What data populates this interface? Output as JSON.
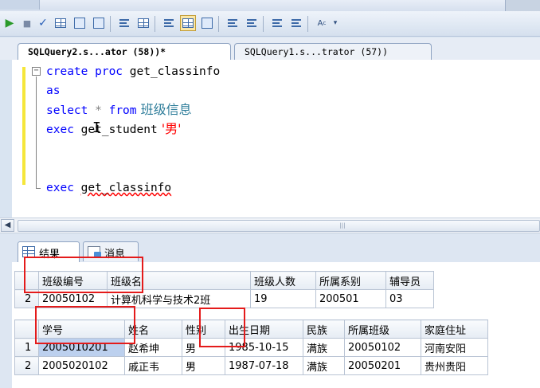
{
  "toolbar": {
    "buttons": [
      "execute",
      "stop",
      "parse",
      "display-estimated-plan",
      "query-options",
      "intellisense",
      "results-to-text",
      "results-to-grid",
      "results-to-file",
      "comment-out",
      "uncomment",
      "decrease-indent",
      "increase-indent",
      "specify-template-values"
    ],
    "active_button": "results-to-grid"
  },
  "tabs": [
    {
      "label": "SQLQuery2.s...ator (58))*",
      "active": true
    },
    {
      "label": "SQLQuery1.s...trator (57))",
      "active": false
    }
  ],
  "editor": {
    "lines": [
      {
        "kw1": "create proc",
        "rest": " get_classinfo"
      },
      {
        "kw1": "as"
      },
      {
        "kw1": "select",
        "star": " * ",
        "kw2": "from",
        "table": " 班级信息"
      },
      {
        "kw1": "exec",
        "proc": " get_student",
        "str": " '男'"
      },
      {
        "kw1": "exec",
        "proc2": "get_classinfo"
      }
    ]
  },
  "results": {
    "tabs": [
      "结果",
      "消息"
    ],
    "grid1": {
      "columns": [
        "班级编号",
        "班级名",
        "班级人数",
        "所属系别",
        "辅导员"
      ],
      "rows": [
        {
          "num": "2",
          "cells": [
            "20050102",
            "计算机科学与技术2班",
            "19",
            "200501",
            "03"
          ]
        }
      ]
    },
    "grid2": {
      "columns": [
        "学号",
        "姓名",
        "性别",
        "出生日期",
        "民族",
        "所属班级",
        "家庭住址"
      ],
      "rows": [
        {
          "num": "1",
          "cells": [
            "2005010201",
            "赵希坤",
            "男",
            "1985-10-15",
            "满族",
            "20050102",
            "河南安阳"
          ]
        },
        {
          "num": "2",
          "cells": [
            "2005020102",
            "戚正韦",
            "男",
            "1987-07-18",
            "满族",
            "20050201",
            "贵州贵阳"
          ]
        }
      ]
    }
  },
  "colors": {
    "keyword": "#0000ff",
    "string": "#ff0000",
    "highlight_box": "#e41b1b",
    "selected_cell": "#bcd0ee"
  }
}
